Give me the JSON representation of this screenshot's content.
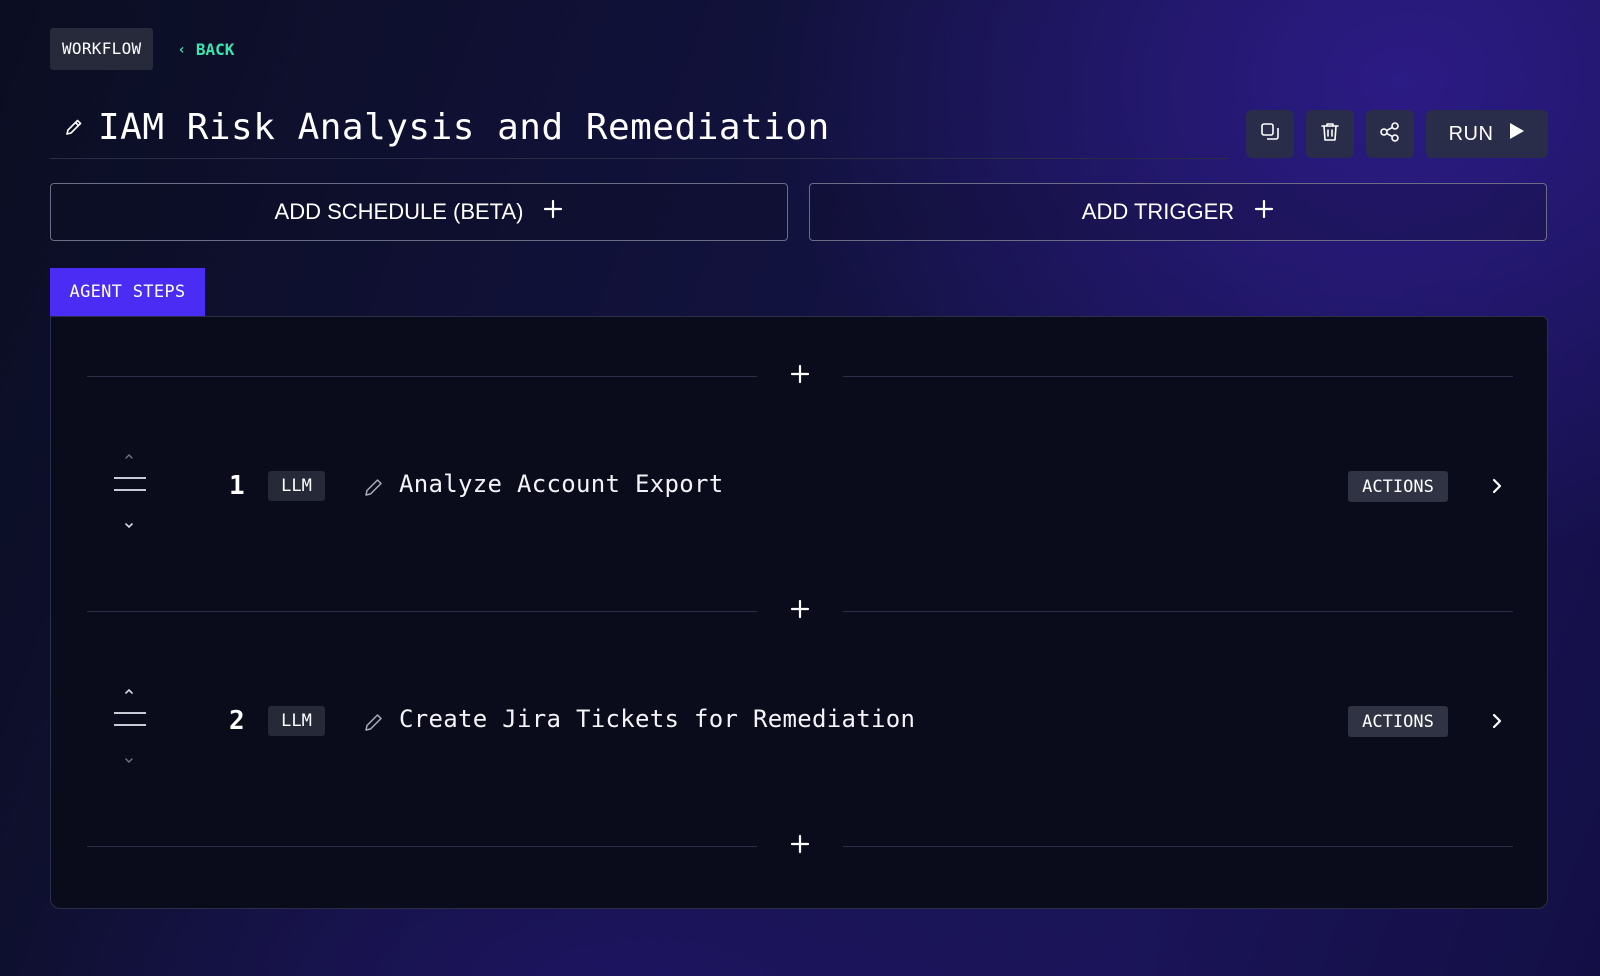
{
  "header": {
    "workflow_label": "WORKFLOW",
    "back_label": "BACK",
    "title": "IAM Risk Analysis and Remediation"
  },
  "toolbar": {
    "duplicate_icon": "copy-icon",
    "delete_icon": "trash-icon",
    "share_icon": "share-icon",
    "run_label": "RUN",
    "run_icon": "play-icon"
  },
  "schedule": {
    "label": "ADD SCHEDULE (BETA)",
    "icon": "plus-icon"
  },
  "trigger": {
    "label": "ADD TRIGGER",
    "icon": "plus-icon"
  },
  "agent_steps": {
    "tab_label": "AGENT STEPS",
    "steps": [
      {
        "number": "1",
        "type": "LLM",
        "title": "Analyze Account Export",
        "actions_label": "ACTIONS"
      },
      {
        "number": "2",
        "type": "LLM",
        "title": "Create Jira Tickets for Remediation",
        "actions_label": "ACTIONS"
      }
    ]
  },
  "colors": {
    "accent": "#4a2cf5",
    "back_link": "#39e6b0",
    "panel_bg": "#0b0c1b",
    "button_bg": "#2a2d4a"
  }
}
